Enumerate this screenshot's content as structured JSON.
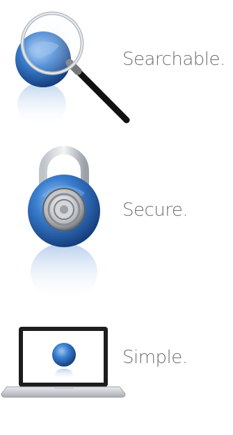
{
  "features": [
    {
      "label": "Searchable.",
      "icon": "magnifier-over-blue-globe-icon"
    },
    {
      "label": "Secure.",
      "icon": "padlock-blue-globe-icon"
    },
    {
      "label": "Simple.",
      "icon": "laptop-blue-globe-icon"
    }
  ],
  "colors": {
    "globe_blue": "#2d6fc4",
    "globe_dark": "#1a4a8f",
    "label_gray": "#6f6f6f",
    "background": "#ffffff"
  }
}
